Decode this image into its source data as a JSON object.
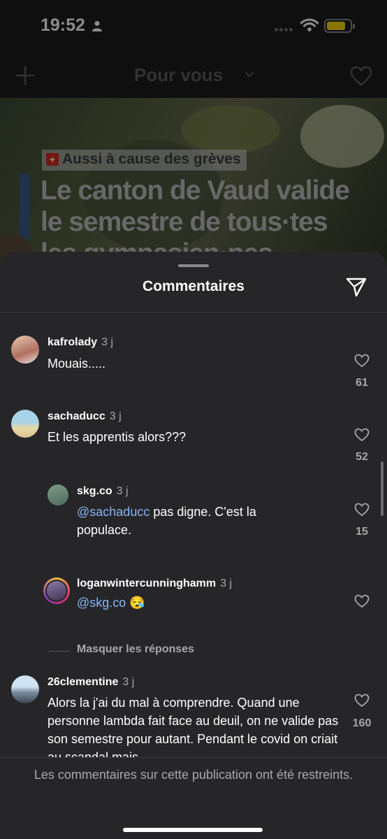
{
  "status_bar": {
    "time": "19:52"
  },
  "top_bar": {
    "title": "Pour vous"
  },
  "post": {
    "tag": "Aussi à cause des grèves",
    "headline_lines": [
      "Le canton de Vaud valide",
      "le semestre de tous·tes",
      "les gymnasien·nes"
    ]
  },
  "sheet": {
    "title": "Commentaires"
  },
  "comments": [
    {
      "username": "kafrolady",
      "ago": "3 j",
      "text": "Mouais.....",
      "likes": "61"
    },
    {
      "username": "sachaducc",
      "ago": "3 j",
      "text": "Et les apprentis alors???",
      "likes": "52"
    },
    {
      "username": "skg.co",
      "ago": "3 j",
      "mention": "@sachaducc",
      "text": " pas digne. C'est la populace.",
      "likes": "15"
    },
    {
      "username": "loganwintercunninghamm",
      "ago": "3 j",
      "mention": "@skg.co",
      "text": " 😪",
      "likes": ""
    },
    {
      "username": "26clementine",
      "ago": "3 j",
      "text": "Alors la j'ai du mal à comprendre. Quand une personne lambda fait face au deuil, on ne valide pas son semestre pour autant. Pendant le covid on criait au scandal mais",
      "likes": "160"
    }
  ],
  "hide_replies": "Masquer les réponses",
  "footer": {
    "text": "Les commentaires sur cette publication ont été restreints."
  },
  "colors": {
    "mention": "#8ab4f8",
    "battery": "#f4d70c",
    "sheet_bg": "#262628"
  }
}
